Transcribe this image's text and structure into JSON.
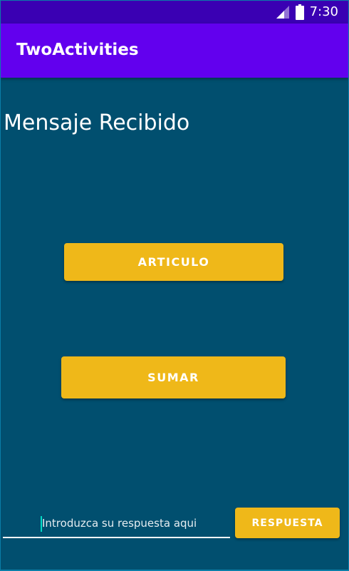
{
  "status_bar": {
    "time": "7:30",
    "icons": [
      "signal-icon",
      "battery-icon"
    ]
  },
  "app_bar": {
    "title": "TwoActivities"
  },
  "main": {
    "message_heading": "Mensaje Recibido",
    "articulo_button_label": "ARTICULO",
    "sumar_button_label": "SUMAR"
  },
  "reply": {
    "input_value": "",
    "placeholder": "Introduzca su respuesta aqui",
    "respuesta_button_label": "RESPUESTA"
  },
  "colors": {
    "status_bar": "#3a00b3",
    "app_bar": "#6200ee",
    "background": "#014f6f",
    "button": "#efb819",
    "cursor_accent": "#03dac5"
  }
}
